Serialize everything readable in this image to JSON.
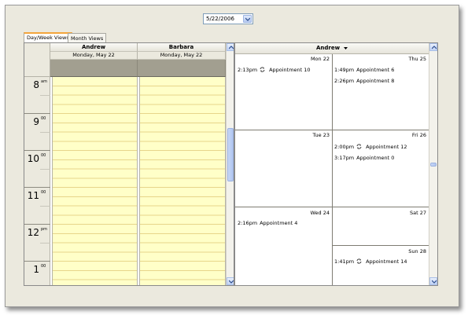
{
  "date_selector": {
    "value": "5/22/2006"
  },
  "tabs": [
    {
      "label": "Day/Week Views",
      "active": true
    },
    {
      "label": "Month Views",
      "active": false
    }
  ],
  "day_view": {
    "resources": [
      "Andrew",
      "Barbara"
    ],
    "date_label": "Monday, May 22",
    "hours": [
      {
        "num": "8",
        "suffix": "am"
      },
      {
        "num": "9",
        "suffix": "00"
      },
      {
        "num": "10",
        "suffix": "00"
      },
      {
        "num": "11",
        "suffix": "00"
      },
      {
        "num": "12",
        "suffix": "pm"
      },
      {
        "num": "1",
        "suffix": "00"
      }
    ]
  },
  "week_view": {
    "resource": "Andrew",
    "days": [
      {
        "label": "Mon 22",
        "appointments": [
          {
            "time": "2:13pm",
            "recurring": true,
            "name": "Appointment 10"
          }
        ]
      },
      {
        "label": "Thu 25",
        "appointments": [
          {
            "time": "1:49pm",
            "recurring": false,
            "name": "Appointment 6"
          },
          {
            "time": "2:26pm",
            "recurring": false,
            "name": "Appointment 8"
          }
        ]
      },
      {
        "label": "Tue 23",
        "appointments": []
      },
      {
        "label": "Fri 26",
        "appointments": [
          {
            "time": "2:00pm",
            "recurring": true,
            "name": "Appointment 12"
          },
          {
            "time": "3:17pm",
            "recurring": false,
            "name": "Appointment 0"
          }
        ]
      },
      {
        "label": "Wed 24",
        "appointments": [
          {
            "time": "2:16pm",
            "recurring": false,
            "name": "Appointment 4"
          }
        ]
      },
      {
        "label": "Sat 27",
        "appointments": []
      },
      {
        "label": "Sun 28",
        "appointments": [
          {
            "time": "1:41pm",
            "recurring": true,
            "name": "Appointment 14"
          }
        ]
      }
    ]
  },
  "colors": {
    "slot_background": "#ffffc8",
    "allday_bar": "#a29f90",
    "active_tab_accent": "#f3a53c"
  }
}
